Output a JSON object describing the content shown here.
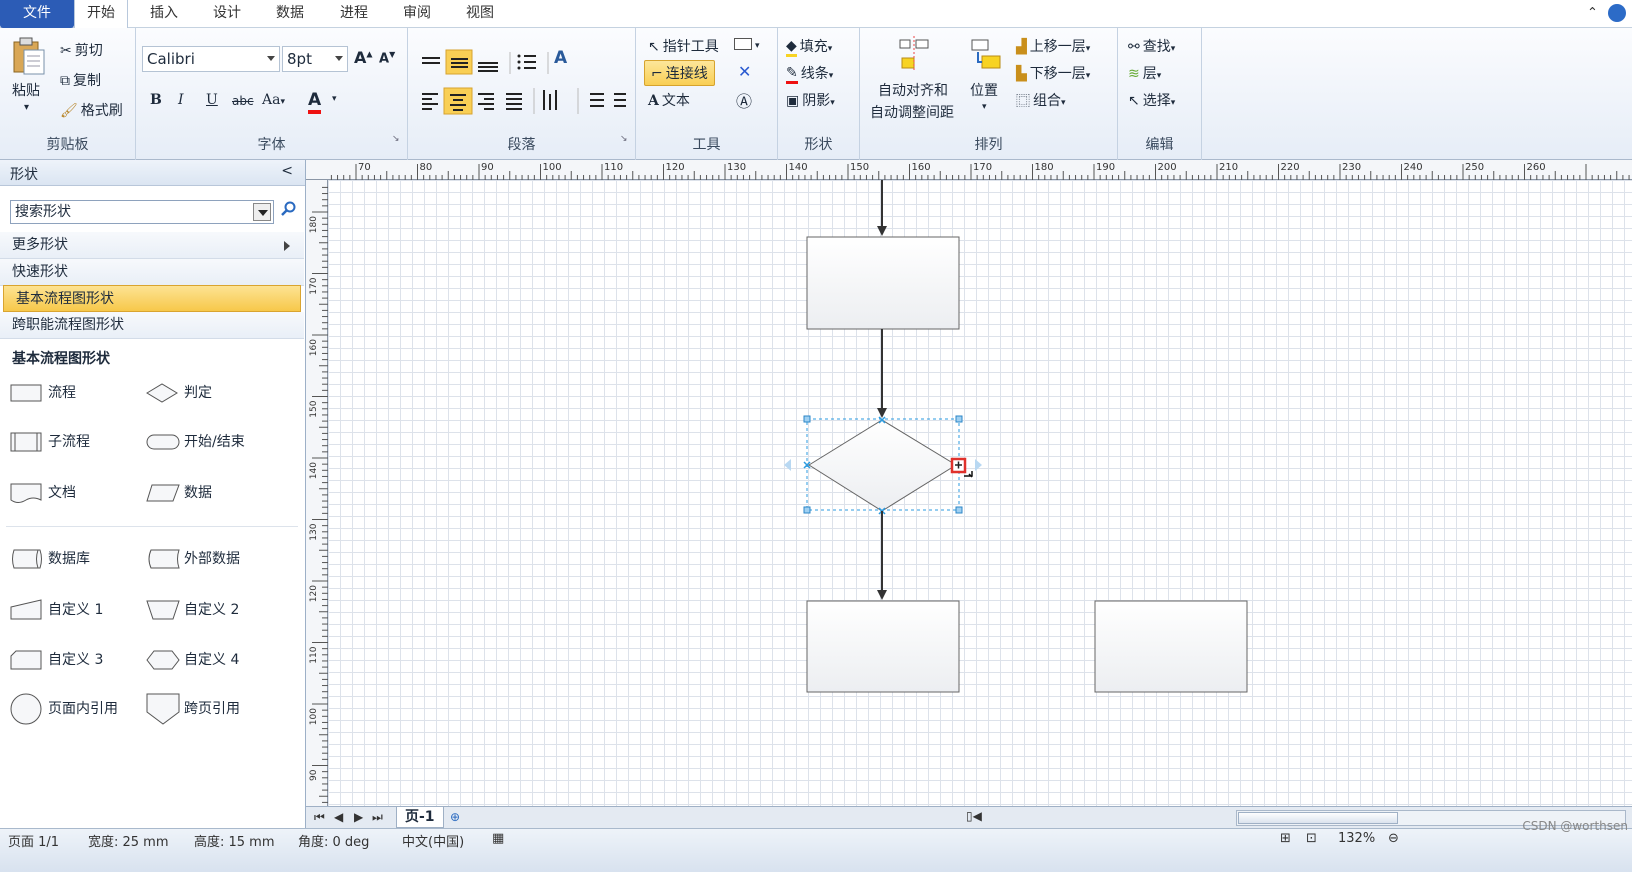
{
  "tabs": {
    "file": "文件",
    "home": "开始",
    "insert": "插入",
    "design": "设计",
    "data": "数据",
    "process": "进程",
    "review": "审阅",
    "view": "视图"
  },
  "ribbon": {
    "clipboard": {
      "label": "剪贴板",
      "paste": "粘贴",
      "cut": "剪切",
      "copy": "复制",
      "format_painter": "格式刷"
    },
    "font": {
      "label": "字体",
      "font_name": "Calibri",
      "font_size": "8pt",
      "bold": "B",
      "italic": "I",
      "underline": "U",
      "strike": "abc",
      "case": "Aa",
      "color_a": "A",
      "grow": "A",
      "shrink": "A"
    },
    "paragraph": {
      "label": "段落",
      "text_a": "A"
    },
    "tools": {
      "label": "工具",
      "pointer": "指针工具",
      "connector": "连接线",
      "text": "文本",
      "close_x": "✕"
    },
    "shape": {
      "label": "形状",
      "fill": "填充",
      "line": "线条",
      "shadow": "阴影"
    },
    "arrange": {
      "label": "排列",
      "auto_align": "自动对齐和",
      "auto_space": "自动调整间距",
      "position": "位置",
      "bring_forward": "上移一层",
      "send_backward": "下移一层",
      "group": "组合"
    },
    "editing": {
      "label": "编辑",
      "find": "查找",
      "layers": "层",
      "select": "选择"
    }
  },
  "shapes_panel": {
    "title": "形状",
    "collapse": "<",
    "search_placeholder": "搜索形状",
    "more_shapes": "更多形状",
    "quick_shapes": "快速形状",
    "basic_flowchart": "基本流程图形状",
    "cross_functional": "跨职能流程图形状",
    "section_title": "基本流程图形状",
    "items": [
      {
        "label": "流程",
        "icon": "process-shape-icon"
      },
      {
        "label": "判定",
        "icon": "decision-shape-icon"
      },
      {
        "label": "子流程",
        "icon": "subprocess-shape-icon"
      },
      {
        "label": "开始/结束",
        "icon": "terminator-shape-icon"
      },
      {
        "label": "文档",
        "icon": "document-shape-icon"
      },
      {
        "label": "数据",
        "icon": "data-shape-icon"
      },
      {
        "label": "数据库",
        "icon": "database-shape-icon"
      },
      {
        "label": "外部数据",
        "icon": "external-data-shape-icon"
      },
      {
        "label": "自定义 1",
        "icon": "custom1-shape-icon"
      },
      {
        "label": "自定义 2",
        "icon": "custom2-shape-icon"
      },
      {
        "label": "自定义 3",
        "icon": "custom3-shape-icon"
      },
      {
        "label": "自定义 4",
        "icon": "custom4-shape-icon"
      },
      {
        "label": "页面内引用",
        "icon": "on-page-reference-icon"
      },
      {
        "label": "跨页引用",
        "icon": "off-page-reference-icon"
      }
    ]
  },
  "rulers": {
    "top": [
      "70",
      "80",
      "90",
      "100",
      "110",
      "120",
      "130",
      "140",
      "150",
      "160",
      "170",
      "180",
      "190",
      "200",
      "210",
      "220",
      "230",
      "240",
      "250",
      "260"
    ],
    "left": [
      "180",
      "170",
      "160",
      "150",
      "140",
      "130",
      "120",
      "110",
      "100",
      "90"
    ]
  },
  "page_tabs": {
    "current": "页-1"
  },
  "status": {
    "page": "页面 1/1",
    "width": "宽度: 25 mm",
    "height": "高度: 15 mm",
    "angle": "角度: 0 deg",
    "language": "中文(中国)",
    "zoom": "132%",
    "watermark": "CSDN @worthsen"
  },
  "colors": {
    "accent": "#2c5cb6",
    "highlight": "#f9cf55",
    "selection": "#2b9be0"
  }
}
